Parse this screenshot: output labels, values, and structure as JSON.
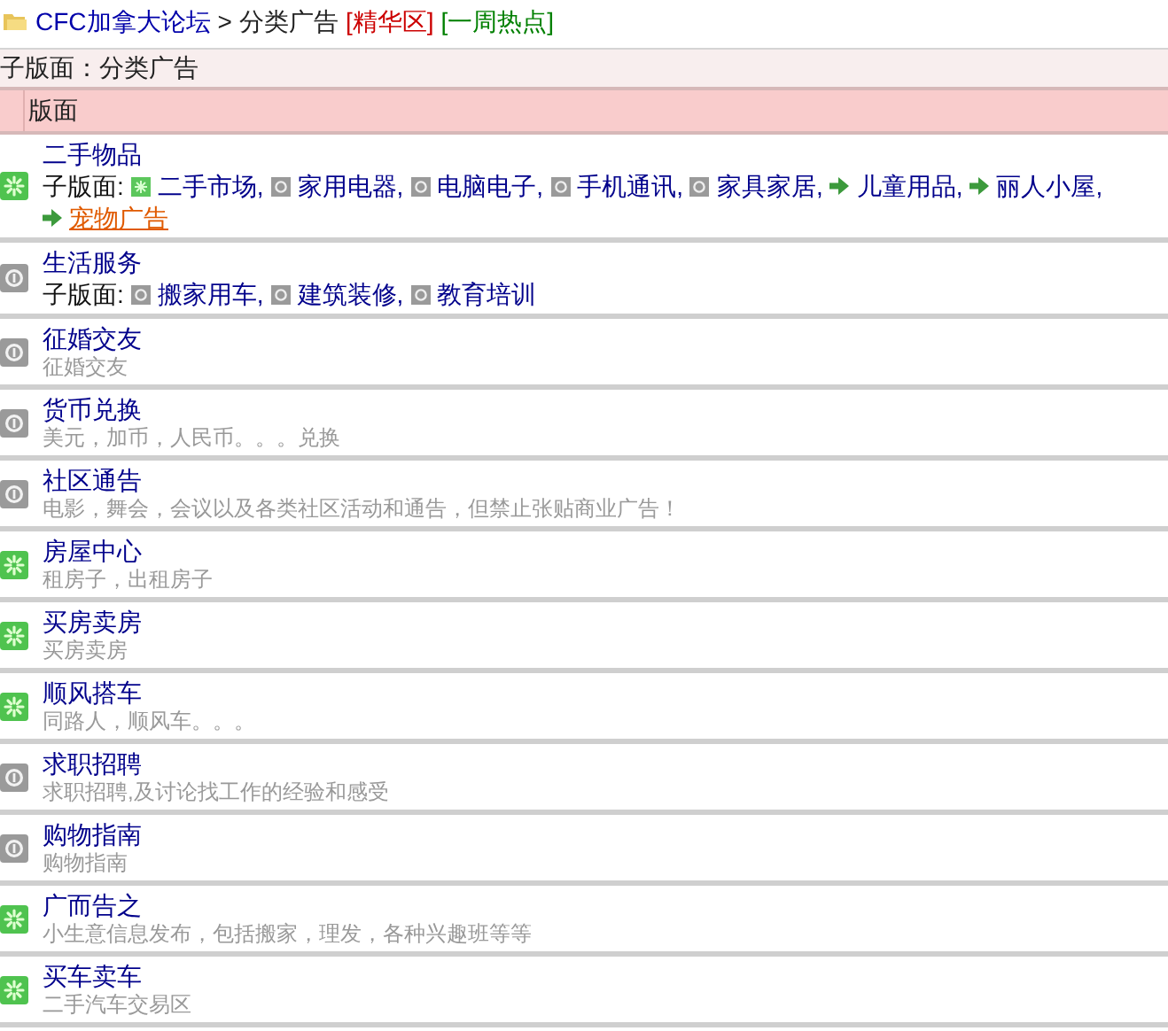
{
  "breadcrumb": {
    "home": "CFC加拿大论坛",
    "separator": ">",
    "current": "分类广告",
    "links": [
      {
        "text": "[精华区]",
        "color": "#cc0000"
      },
      {
        "text": "[一周热点]",
        "color": "#008000"
      }
    ]
  },
  "subtitle": "子版面：分类广告",
  "table": {
    "header": "版面",
    "rows": [
      {
        "kind": "new",
        "title": "二手物品",
        "sub_label": "子版面:",
        "subboards": [
          {
            "kind": "new",
            "text": "二手市场,",
            "highlighted": false
          },
          {
            "kind": "old",
            "text": "家用电器,",
            "highlighted": false
          },
          {
            "kind": "old",
            "text": "电脑电子,",
            "highlighted": false
          },
          {
            "kind": "old",
            "text": "手机通讯,",
            "highlighted": false
          },
          {
            "kind": "old",
            "text": "家具家居,",
            "highlighted": false
          },
          {
            "kind": "link",
            "text": "儿童用品,",
            "highlighted": false
          },
          {
            "kind": "link",
            "text": "丽人小屋,",
            "highlighted": false
          },
          {
            "kind": "link",
            "text": "宠物广告",
            "highlighted": true
          }
        ]
      },
      {
        "kind": "old",
        "title": "生活服务",
        "sub_label": "子版面:",
        "subboards": [
          {
            "kind": "old",
            "text": "搬家用车,",
            "highlighted": false
          },
          {
            "kind": "old",
            "text": "建筑装修,",
            "highlighted": false
          },
          {
            "kind": "old",
            "text": "教育培训",
            "highlighted": false
          }
        ]
      },
      {
        "kind": "old",
        "title": "征婚交友",
        "description": "征婚交友"
      },
      {
        "kind": "old",
        "title": "货币兑换",
        "description": "美元，加币，人民币。。。兑换"
      },
      {
        "kind": "old",
        "title": "社区通告",
        "description": "电影，舞会，会议以及各类社区活动和通告，但禁止张贴商业广告！"
      },
      {
        "kind": "new",
        "title": "房屋中心",
        "description": "租房子，出租房子"
      },
      {
        "kind": "new",
        "title": "买房卖房",
        "description": "买房卖房"
      },
      {
        "kind": "new",
        "title": "顺风搭车",
        "description": "同路人，顺风车。。。"
      },
      {
        "kind": "old",
        "title": "求职招聘",
        "description": "求职招聘,及讨论找工作的经验和感受"
      },
      {
        "kind": "old",
        "title": "购物指南",
        "description": "购物指南"
      },
      {
        "kind": "new",
        "title": "广而告之",
        "description": "小生意信息发布，包括搬家，理发，各种兴趣班等等"
      },
      {
        "kind": "new",
        "title": "买车卖车",
        "description": "二手汽车交易区"
      }
    ]
  }
}
